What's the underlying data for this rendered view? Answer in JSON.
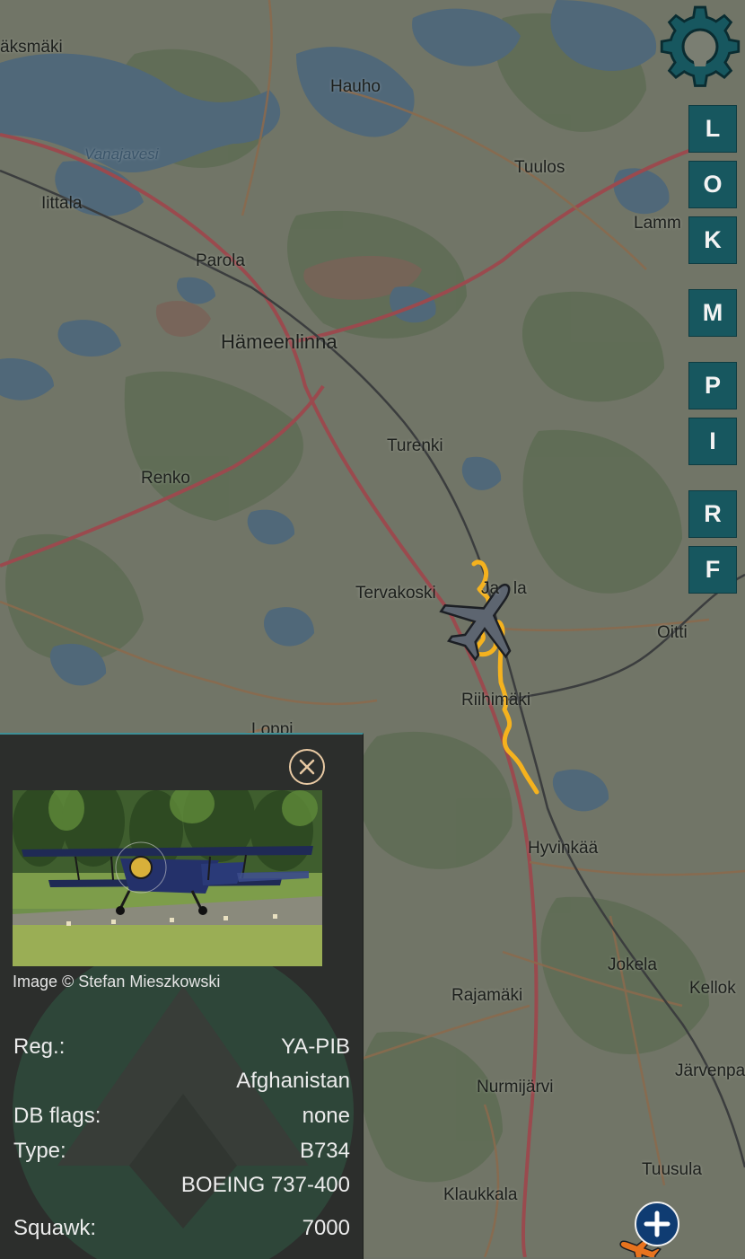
{
  "map": {
    "places": {
      "aksmaki": "äksmäki",
      "hauho": "Hauho",
      "vanajavesi": "Vanajavesi",
      "tuulos": "Tuulos",
      "iittala": "Iittala",
      "lamm": "Lamm",
      "parola": "Parola",
      "hameenlinna": "Hämeenlinna",
      "turenki": "Turenki",
      "renko": "Renko",
      "tervakoski": "Tervakoski",
      "janakkala": "Ja   la",
      "oitti": "Oitti",
      "riihimaki": "Riihimäki",
      "loppi": "Loppi",
      "hyvinkaa": "Hyvinkää",
      "jokela": "Jokela",
      "kellok": "Kellok",
      "rajamaki": "Rajamäki",
      "jarvenpaa": "Järvenpa",
      "nurmijarvi": "Nurmijärvi",
      "tuusula": "Tuusula",
      "klaukkala": "Klaukkala"
    }
  },
  "colors": {
    "track": "#f5b21e",
    "button_bg": "#17575f",
    "panel_bg": "#2c2e2c",
    "aircraft": "#5d6570",
    "zoom_bg": "#0f3c72"
  },
  "toolbar": {
    "settings_icon": "gear-icon",
    "keys": [
      "L",
      "O",
      "K",
      "M",
      "P",
      "I",
      "R",
      "F"
    ]
  },
  "aircraft_panel": {
    "close_icon": "close-icon",
    "photo_credit": "Image © Stefan Mieszkowski",
    "reg_label": "Reg.:",
    "reg_value": "YA-PIB",
    "country": "Afghanistan",
    "db_flags_label": "DB flags:",
    "db_flags_value": "none",
    "type_label": "Type:",
    "type_value": "B734",
    "type_full": "BOEING 737-400",
    "squawk_label": "Squawk:",
    "squawk_value": "7000"
  },
  "zoom": {
    "icon": "plus-icon"
  }
}
